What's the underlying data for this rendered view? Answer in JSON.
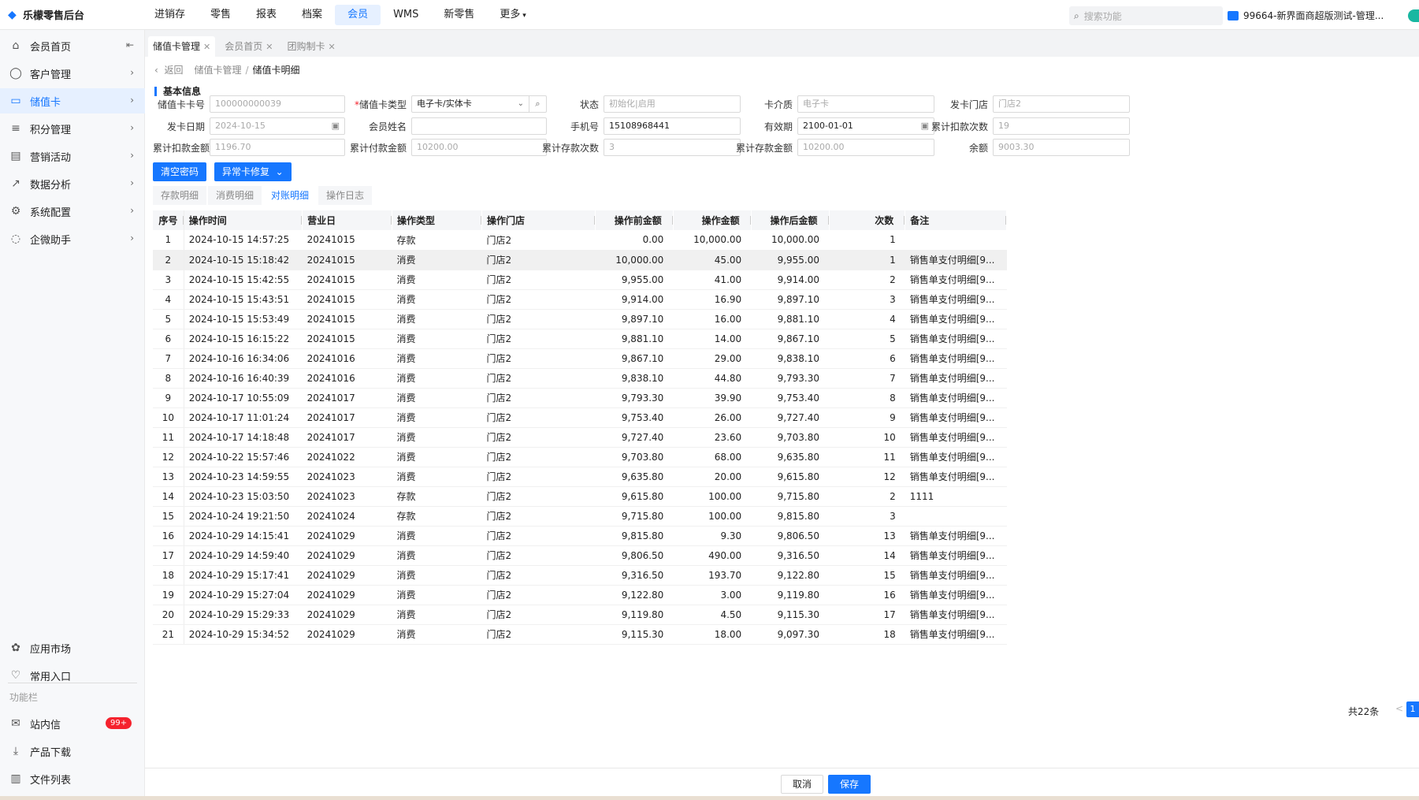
{
  "app": {
    "title": "乐檬零售后台"
  },
  "topnav": [
    "进销存",
    "零售",
    "报表",
    "档案",
    "会员",
    "WMS",
    "新零售",
    "更多"
  ],
  "topnav_active": "会员",
  "search_placeholder": "搜索功能",
  "account": "99664-新界面商超版测试-管理...",
  "sidebar": {
    "collapse_icon": "collapse-left-icon",
    "items": [
      {
        "label": "会员首页",
        "icon": "home-icon"
      },
      {
        "label": "客户管理",
        "icon": "user-icon"
      },
      {
        "label": "储值卡",
        "icon": "card-icon"
      },
      {
        "label": "积分管理",
        "icon": "database-icon"
      },
      {
        "label": "营销活动",
        "icon": "campaign-icon"
      },
      {
        "label": "数据分析",
        "icon": "chart-icon"
      },
      {
        "label": "系统配置",
        "icon": "settings-icon"
      },
      {
        "label": "企微助手",
        "icon": "chat-icon"
      }
    ],
    "active": "储值卡",
    "bottom": [
      {
        "label": "应用市场",
        "icon": "app-market-icon"
      },
      {
        "label": "常用入口",
        "icon": "heart-icon"
      }
    ],
    "section_label": "功能栏",
    "tools": [
      {
        "label": "站内信",
        "icon": "mail-icon",
        "badge": "99+"
      },
      {
        "label": "产品下载",
        "icon": "download-icon"
      },
      {
        "label": "文件列表",
        "icon": "file-list-icon"
      }
    ]
  },
  "page_tabs": [
    {
      "label": "储值卡管理",
      "active": true
    },
    {
      "label": "会员首页",
      "active": false
    },
    {
      "label": "团购制卡",
      "active": false
    }
  ],
  "breadcrumb": {
    "back": "返回",
    "parent": "储值卡管理",
    "sep": "/",
    "current": "储值卡明细"
  },
  "section_title": "基本信息",
  "form": {
    "card_no": {
      "label": "储值卡卡号",
      "value": "100000000039"
    },
    "card_type": {
      "label": "储值卡类型",
      "value": "电子卡/实体卡"
    },
    "status": {
      "label": "状态",
      "value": "初始化|启用"
    },
    "medium": {
      "label": "卡介质",
      "value": "电子卡"
    },
    "issue_store": {
      "label": "发卡门店",
      "value": "门店2"
    },
    "issue_date": {
      "label": "发卡日期",
      "value": "2024-10-15"
    },
    "member_name": {
      "label": "会员姓名",
      "value": ""
    },
    "phone": {
      "label": "手机号",
      "value": "15108968441"
    },
    "expiry": {
      "label": "有效期",
      "value": "2100-01-01"
    },
    "deduct_count": {
      "label": "累计扣款次数",
      "value": "19"
    },
    "deduct_amount": {
      "label": "累计扣款金额",
      "value": "1196.70"
    },
    "pay_amount": {
      "label": "累计付款金额",
      "value": "10200.00"
    },
    "deposit_count": {
      "label": "累计存款次数",
      "value": "3"
    },
    "deposit_amount": {
      "label": "累计存款金额",
      "value": "10200.00"
    },
    "balance": {
      "label": "余额",
      "value": "9003.30"
    }
  },
  "actions": {
    "clear_password": "清空密码",
    "repair": "异常卡修复"
  },
  "subtabs": [
    "存款明细",
    "消费明细",
    "对账明细",
    "操作日志"
  ],
  "subtab_active": "对账明细",
  "table": {
    "columns": [
      "序号",
      "操作时间",
      "营业日",
      "操作类型",
      "操作门店",
      "操作前金额",
      "操作金额",
      "操作后金额",
      "次数",
      "备注"
    ],
    "rows": [
      [
        "1",
        "2024-10-15 14:57:25",
        "20241015",
        "存款",
        "门店2",
        "0.00",
        "10,000.00",
        "10,000.00",
        "1",
        ""
      ],
      [
        "2",
        "2024-10-15 15:18:42",
        "20241015",
        "消费",
        "门店2",
        "10,000.00",
        "45.00",
        "9,955.00",
        "1",
        "销售单支付明细[9..."
      ],
      [
        "3",
        "2024-10-15 15:42:55",
        "20241015",
        "消费",
        "门店2",
        "9,955.00",
        "41.00",
        "9,914.00",
        "2",
        "销售单支付明细[9..."
      ],
      [
        "4",
        "2024-10-15 15:43:51",
        "20241015",
        "消费",
        "门店2",
        "9,914.00",
        "16.90",
        "9,897.10",
        "3",
        "销售单支付明细[9..."
      ],
      [
        "5",
        "2024-10-15 15:53:49",
        "20241015",
        "消费",
        "门店2",
        "9,897.10",
        "16.00",
        "9,881.10",
        "4",
        "销售单支付明细[9..."
      ],
      [
        "6",
        "2024-10-15 16:15:22",
        "20241015",
        "消费",
        "门店2",
        "9,881.10",
        "14.00",
        "9,867.10",
        "5",
        "销售单支付明细[9..."
      ],
      [
        "7",
        "2024-10-16 16:34:06",
        "20241016",
        "消费",
        "门店2",
        "9,867.10",
        "29.00",
        "9,838.10",
        "6",
        "销售单支付明细[9..."
      ],
      [
        "8",
        "2024-10-16 16:40:39",
        "20241016",
        "消费",
        "门店2",
        "9,838.10",
        "44.80",
        "9,793.30",
        "7",
        "销售单支付明细[9..."
      ],
      [
        "9",
        "2024-10-17 10:55:09",
        "20241017",
        "消费",
        "门店2",
        "9,793.30",
        "39.90",
        "9,753.40",
        "8",
        "销售单支付明细[9..."
      ],
      [
        "10",
        "2024-10-17 11:01:24",
        "20241017",
        "消费",
        "门店2",
        "9,753.40",
        "26.00",
        "9,727.40",
        "9",
        "销售单支付明细[9..."
      ],
      [
        "11",
        "2024-10-17 14:18:48",
        "20241017",
        "消费",
        "门店2",
        "9,727.40",
        "23.60",
        "9,703.80",
        "10",
        "销售单支付明细[9..."
      ],
      [
        "12",
        "2024-10-22 15:57:46",
        "20241022",
        "消费",
        "门店2",
        "9,703.80",
        "68.00",
        "9,635.80",
        "11",
        "销售单支付明细[9..."
      ],
      [
        "13",
        "2024-10-23 14:59:55",
        "20241023",
        "消费",
        "门店2",
        "9,635.80",
        "20.00",
        "9,615.80",
        "12",
        "销售单支付明细[9..."
      ],
      [
        "14",
        "2024-10-23 15:03:50",
        "20241023",
        "存款",
        "门店2",
        "9,615.80",
        "100.00",
        "9,715.80",
        "2",
        "1111"
      ],
      [
        "15",
        "2024-10-24 19:21:50",
        "20241024",
        "存款",
        "门店2",
        "9,715.80",
        "100.00",
        "9,815.80",
        "3",
        ""
      ],
      [
        "16",
        "2024-10-29 14:15:41",
        "20241029",
        "消费",
        "门店2",
        "9,815.80",
        "9.30",
        "9,806.50",
        "13",
        "销售单支付明细[9..."
      ],
      [
        "17",
        "2024-10-29 14:59:40",
        "20241029",
        "消费",
        "门店2",
        "9,806.50",
        "490.00",
        "9,316.50",
        "14",
        "销售单支付明细[9..."
      ],
      [
        "18",
        "2024-10-29 15:17:41",
        "20241029",
        "消费",
        "门店2",
        "9,316.50",
        "193.70",
        "9,122.80",
        "15",
        "销售单支付明细[9..."
      ],
      [
        "19",
        "2024-10-29 15:27:04",
        "20241029",
        "消费",
        "门店2",
        "9,122.80",
        "3.00",
        "9,119.80",
        "16",
        "销售单支付明细[9..."
      ],
      [
        "20",
        "2024-10-29 15:29:33",
        "20241029",
        "消费",
        "门店2",
        "9,119.80",
        "4.50",
        "9,115.30",
        "17",
        "销售单支付明细[9..."
      ],
      [
        "21",
        "2024-10-29 15:34:52",
        "20241029",
        "消费",
        "门店2",
        "9,115.30",
        "18.00",
        "9,097.30",
        "18",
        "销售单支付明细[9..."
      ]
    ],
    "selected_row": 2
  },
  "pager": {
    "total": "共22条",
    "page": "1",
    "prev": "<"
  },
  "footer": {
    "cancel": "取消",
    "save": "保存"
  },
  "colors": {
    "accent": "#1677ff",
    "badge": "#f5222d"
  }
}
